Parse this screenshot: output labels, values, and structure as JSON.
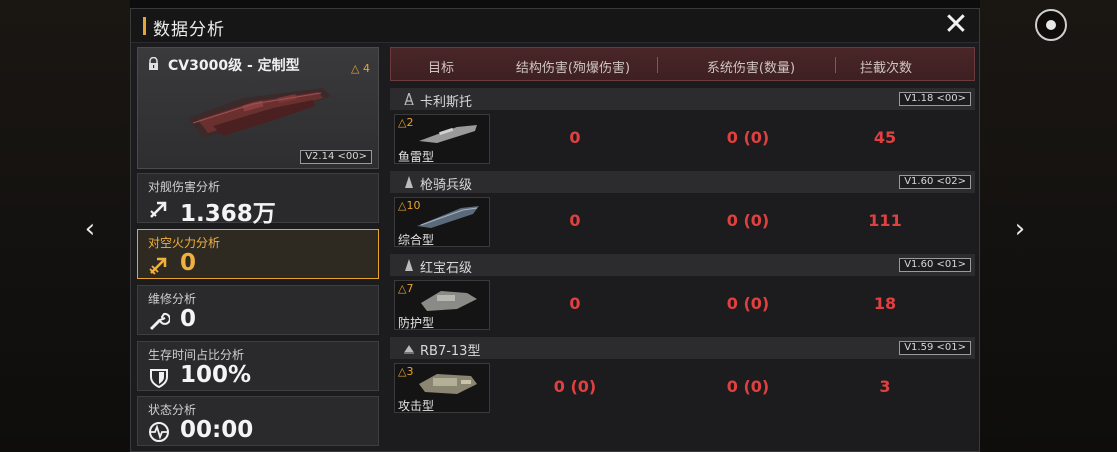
{
  "header": {
    "title": "数据分析"
  },
  "ship": {
    "name": "CV3000级 - 定制型",
    "rank": "△ 4",
    "version": "V2.14 <00>"
  },
  "stats": [
    {
      "label": "对舰伤害分析",
      "value": "1.368万",
      "icon": "damage-arrow-icon"
    },
    {
      "label": "对空火力分析",
      "value": "0",
      "icon": "anti-air-icon",
      "active": true
    },
    {
      "label": "维修分析",
      "value": "0",
      "icon": "wrench-icon"
    },
    {
      "label": "生存时间占比分析",
      "value": "100%",
      "icon": "shield-icon"
    },
    {
      "label": "状态分析",
      "value": "00:00",
      "icon": "heartbeat-icon"
    }
  ],
  "table": {
    "headers": [
      "目标",
      "结构伤害(殉爆伤害)",
      "系统伤害(数量)",
      "拦截次数"
    ],
    "groups": [
      {
        "name": "卡利斯托",
        "version": "V1.18 <00>",
        "unit": {
          "level": "△2",
          "type": "鱼雷型",
          "structure": "0",
          "system": "0 (0)",
          "intercepts": "45"
        }
      },
      {
        "name": "枪骑兵级",
        "version": "V1.60 <02>",
        "unit": {
          "level": "△10",
          "type": "综合型",
          "structure": "0",
          "system": "0 (0)",
          "intercepts": "111"
        }
      },
      {
        "name": "红宝石级",
        "version": "V1.60 <01>",
        "unit": {
          "level": "△7",
          "type": "防护型",
          "structure": "0",
          "system": "0 (0)",
          "intercepts": "18"
        }
      },
      {
        "name": "RB7-13型",
        "version": "V1.59 <01>",
        "unit": {
          "level": "△3",
          "type": "攻击型",
          "structure": "0 (0)",
          "system": "0 (0)",
          "intercepts": "3"
        }
      }
    ]
  },
  "nav": {
    "prev": "‹",
    "next": "›",
    "close": "✕"
  },
  "colors": {
    "accent": "#e8a330",
    "damage_red": "#e04040",
    "header_red": "#4a2628"
  }
}
